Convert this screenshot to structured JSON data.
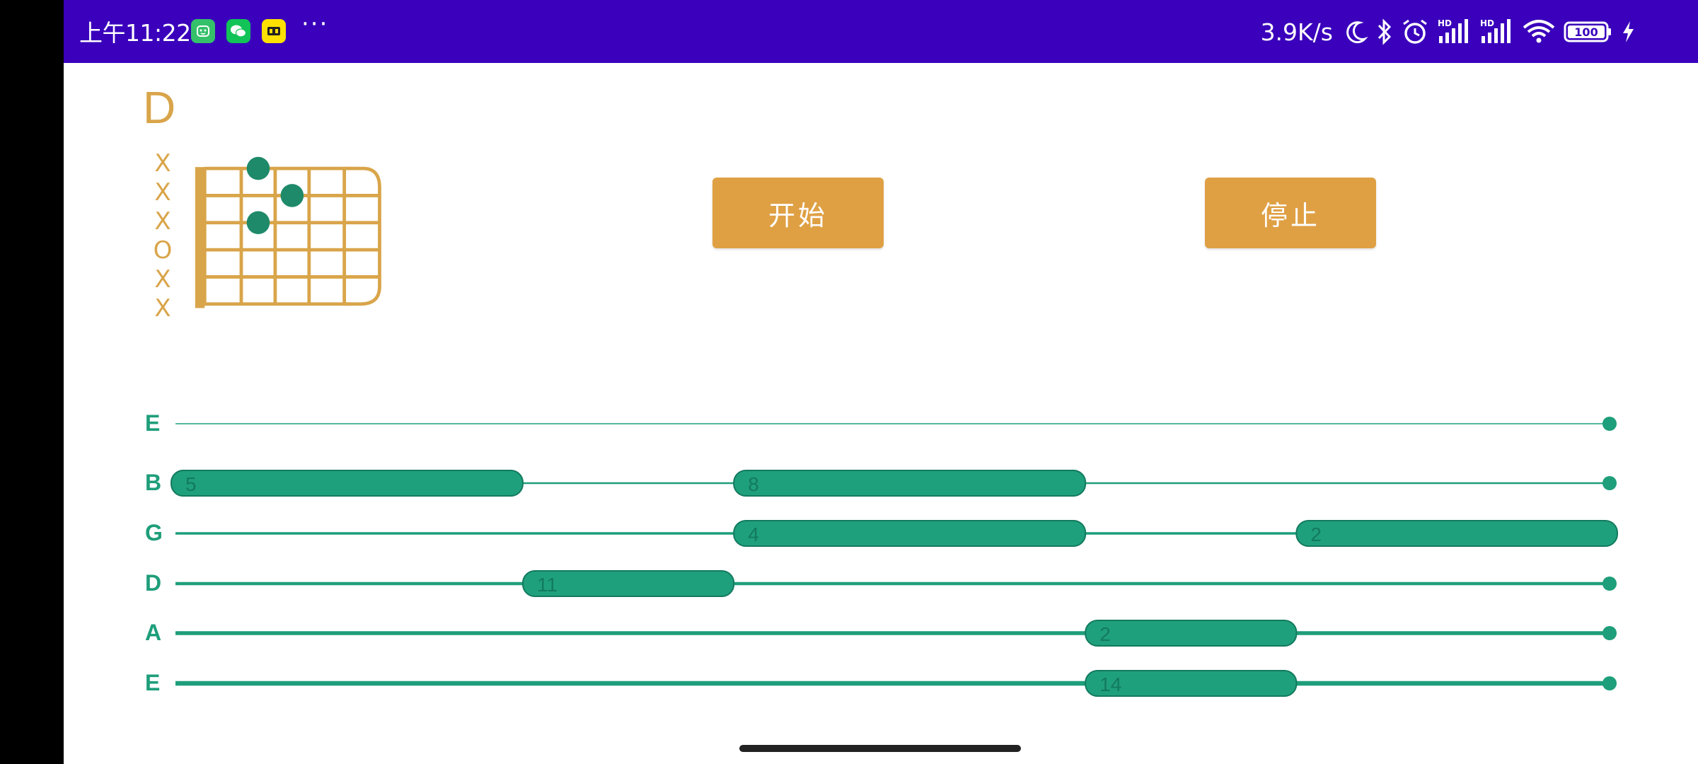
{
  "status_bar": {
    "time": "上午11:22",
    "more": "···",
    "network_speed": "3.9K/s",
    "battery": "100",
    "icons": [
      "app-green-icon",
      "wechat-icon",
      "app-yellow-icon",
      "moon-icon",
      "bluetooth-icon",
      "alarm-icon",
      "signal-hd-icon",
      "signal-hd-icon",
      "wifi-icon",
      "battery-icon",
      "charging-icon"
    ],
    "bg_color": "#3A00BC"
  },
  "chord": {
    "name": "D",
    "string_marks": [
      "X",
      "X",
      "X",
      "O",
      "X",
      "X"
    ],
    "dots": [
      {
        "string": 1,
        "fret": 2
      },
      {
        "string": 2,
        "fret": 3
      },
      {
        "string": 3,
        "fret": 2
      }
    ],
    "color": "#D9A54A",
    "dot_color": "#1E8A6A"
  },
  "buttons": {
    "start": "开始",
    "stop": "停止",
    "color": "#DFA044"
  },
  "tab": {
    "strings": [
      "E",
      "B",
      "G",
      "D",
      "A",
      "E"
    ],
    "line_color": "#1E9E7A",
    "notes": [
      {
        "string": 1,
        "fret": "5",
        "start": 0,
        "end": 1
      },
      {
        "string": 1,
        "fret": "8",
        "start": 1.6,
        "end": 2.6
      },
      {
        "string": 2,
        "fret": "4",
        "start": 1.6,
        "end": 2.6
      },
      {
        "string": 2,
        "fret": "2",
        "start": 3.2,
        "end": 4.2
      },
      {
        "string": 3,
        "fret": "11",
        "start": 1,
        "end": 1.6
      },
      {
        "string": 4,
        "fret": "2",
        "start": 2.6,
        "end": 3.2
      },
      {
        "string": 5,
        "fret": "14",
        "start": 2.6,
        "end": 3.2
      }
    ]
  }
}
